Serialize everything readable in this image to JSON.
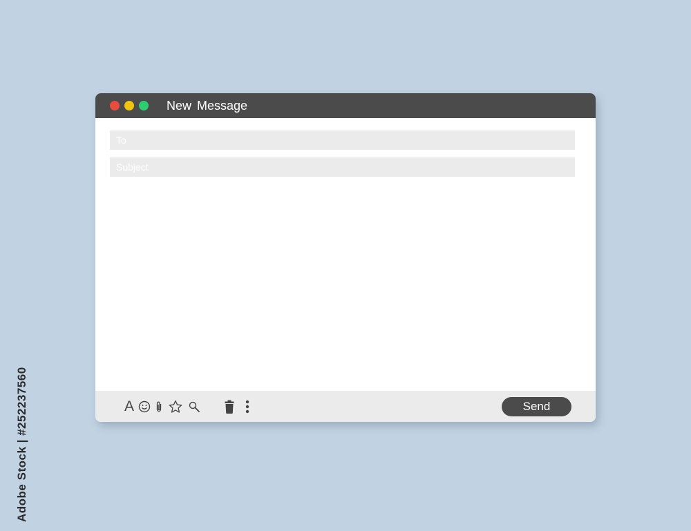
{
  "window": {
    "title": "New  Message",
    "controls": [
      "close",
      "minimize",
      "maximize"
    ]
  },
  "compose": {
    "to_placeholder": "To",
    "to_value": "",
    "subject_placeholder": "Subject",
    "subject_value": "",
    "body_value": ""
  },
  "toolbar": {
    "font_label": "A",
    "icons": [
      "font-format-icon",
      "emoji-icon",
      "paperclip-icon",
      "star-icon",
      "search-icon",
      "trash-icon",
      "more-vertical-icon"
    ],
    "send_label": "Send"
  },
  "side_text": "Adobe Stock | #252237560",
  "colors": {
    "background": "#c1d3e3",
    "titlebar": "#4b4b4b",
    "field": "#ebebeb",
    "close": "#e74c3c",
    "minimize": "#f1c40f",
    "maximize": "#2ecc71"
  }
}
